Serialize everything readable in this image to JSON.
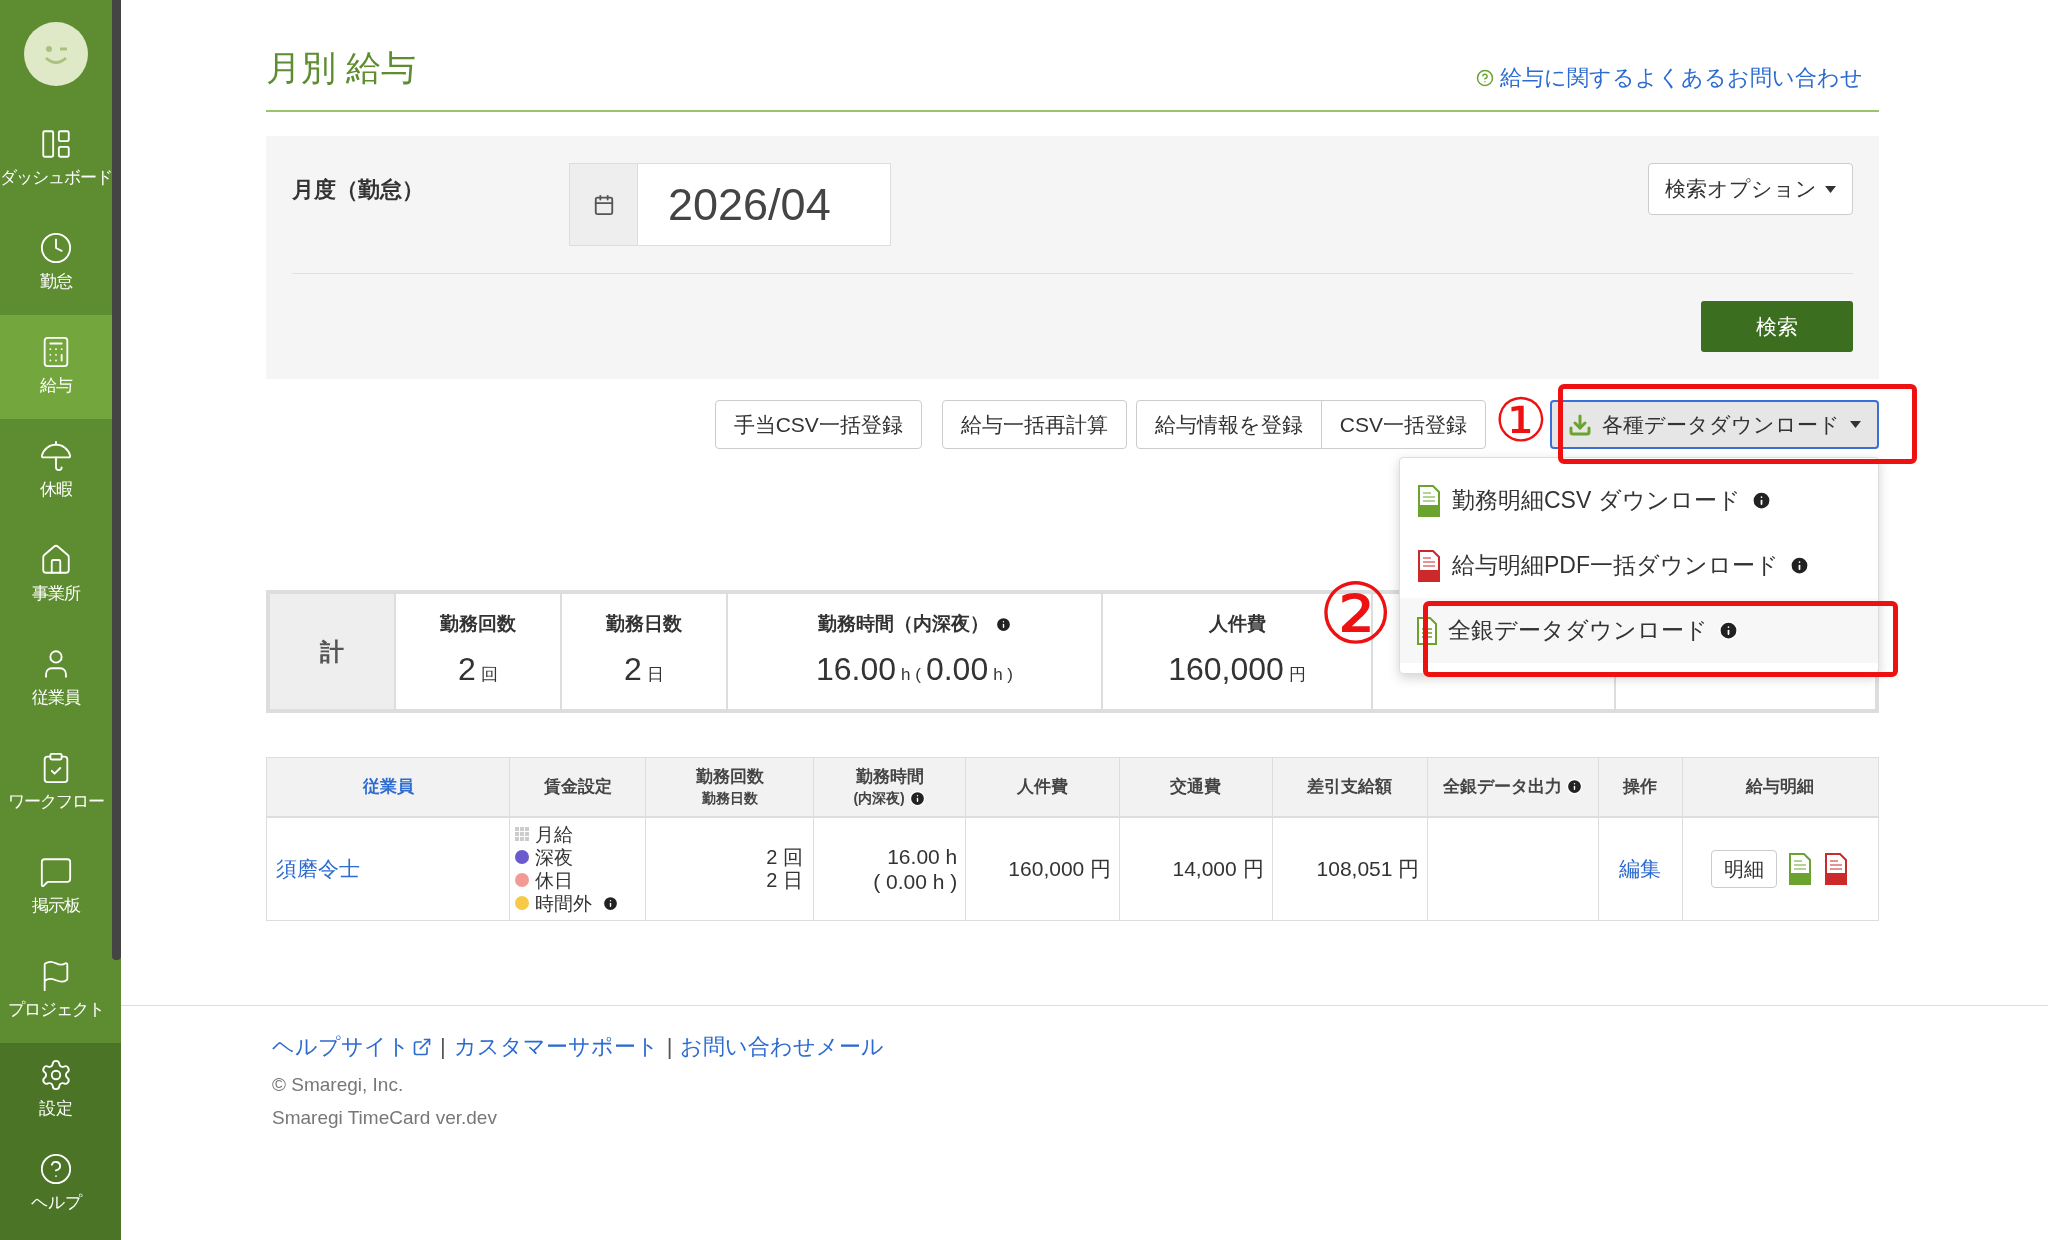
{
  "sidebar": {
    "items": [
      {
        "label": "ダッシュボード",
        "selected": false
      },
      {
        "label": "勤怠",
        "selected": false
      },
      {
        "label": "給与",
        "selected": true
      },
      {
        "label": "休暇",
        "selected": false
      },
      {
        "label": "事業所",
        "selected": false
      },
      {
        "label": "従業員",
        "selected": false
      },
      {
        "label": "ワークフロー",
        "selected": false
      },
      {
        "label": "掲示板",
        "selected": false
      },
      {
        "label": "プロジェクト",
        "selected": false
      }
    ],
    "bottom_items": [
      {
        "label": "設定"
      },
      {
        "label": "ヘルプ"
      }
    ]
  },
  "page": {
    "title": "月別 給与",
    "help_link": "給与に関するよくあるお問い合わせ"
  },
  "search": {
    "label": "月度（勤怠）",
    "month": "2026/04",
    "options_button": "検索オプション",
    "search_button": "検索"
  },
  "actions": {
    "buttons": [
      "手当CSV一括登録",
      "給与一括再計算"
    ],
    "group": [
      "給与情報を登録",
      "CSV一括登録"
    ],
    "download_button": "各種データダウンロード",
    "menu": [
      {
        "label": "勤務明細CSV ダウンロード",
        "kind": "csv",
        "selected": false
      },
      {
        "label": "給与明細PDF一括ダウンロード",
        "kind": "pdf",
        "selected": false
      },
      {
        "label": "全銀データダウンロード",
        "kind": "doc",
        "selected": true
      }
    ]
  },
  "annotations": [
    {
      "label": "①"
    },
    {
      "label": "②"
    }
  ],
  "totals": {
    "heading": "計",
    "cells": [
      {
        "label": "勤務回数",
        "parts": [
          {
            "value": "2",
            "unit": "回"
          }
        ]
      },
      {
        "label": "勤務日数",
        "parts": [
          {
            "value": "2",
            "unit": "日"
          }
        ]
      },
      {
        "label": "勤務時間（内深夜）",
        "info": true,
        "parts": [
          {
            "value": "16.00",
            "unit": "h ("
          },
          {
            "value": "0.00",
            "unit": "h )"
          }
        ]
      },
      {
        "label": "人件費",
        "parts": [
          {
            "value": "160,000",
            "unit": "円"
          }
        ]
      },
      {},
      {}
    ]
  },
  "table": {
    "columns": [
      {
        "label": "従業員",
        "kind": "link"
      },
      {
        "label": "賃金設定",
        "kind": "text"
      },
      {
        "label": "勤務回数",
        "sublabel": "勤務日数",
        "kind": "text"
      },
      {
        "label": "勤務時間",
        "sublabel": "(内深夜)",
        "info": true,
        "kind": "text"
      },
      {
        "label": "人件費",
        "kind": "text"
      },
      {
        "label": "交通費",
        "kind": "text"
      },
      {
        "label": "差引支給額",
        "kind": "text"
      },
      {
        "label": "全銀データ出力",
        "info": true,
        "kind": "text"
      },
      {
        "label": "操作",
        "kind": "text"
      },
      {
        "label": "給与明細",
        "kind": "text"
      }
    ],
    "rows": [
      {
        "employee": "須磨令士",
        "wage_settings": [
          {
            "label": "月給",
            "kind": "grid",
            "color": "#cccccc"
          },
          {
            "label": "深夜",
            "kind": "dot",
            "color": "#6a5acd"
          },
          {
            "label": "休日",
            "kind": "dot",
            "color": "#f29b94"
          },
          {
            "label": "時間外",
            "kind": "dot",
            "color": "#f7c948",
            "info": true
          }
        ],
        "counts": [
          "2 回",
          "2 日"
        ],
        "hours": [
          "16.00 h",
          "( 0.00 h )"
        ],
        "labor_cost": "160,000 円",
        "transport": "14,000 円",
        "net_pay": "108,051 円",
        "edit": "編集",
        "slip_button": "明細"
      }
    ]
  },
  "footer": {
    "separator": "|",
    "links": [
      "ヘルプサイト",
      "カスタマーサポート",
      "お問い合わせメール"
    ],
    "copyright": "© Smaregi, Inc.",
    "version": "Smaregi TimeCard ver.dev"
  }
}
